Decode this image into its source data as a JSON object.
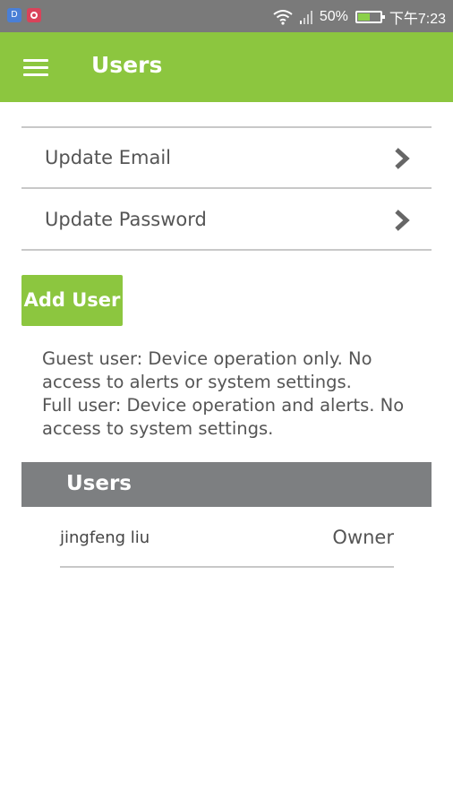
{
  "status_bar": {
    "notif_icon_1": "D",
    "battery_percent": "50%",
    "time": "下午7:23"
  },
  "app_bar": {
    "title": "Users"
  },
  "menu": {
    "items": [
      {
        "label": "Update Email"
      },
      {
        "label": "Update Password"
      }
    ]
  },
  "add_user": {
    "label": "Add User"
  },
  "help": {
    "line1": "Guest user: Device operation only. No access to alerts or system settings.",
    "line2": "Full user: Device operation and alerts. No access to system settings."
  },
  "users_section": {
    "title": "Users",
    "users": [
      {
        "name": "jingfeng liu",
        "role": "Owner"
      }
    ]
  },
  "colors": {
    "accent_green": "#8cc63f",
    "status_bar_gray": "#7a7a7a",
    "section_header_gray": "#7d7f81"
  }
}
